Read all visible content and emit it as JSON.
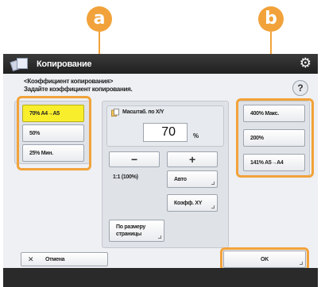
{
  "callouts": {
    "a": "a",
    "b": "b"
  },
  "window": {
    "title": "Копирование",
    "app_icon": "copy-app-icon",
    "settings_icon": "gear-icon"
  },
  "header": {
    "line1": "<Коэффициент копирования>",
    "line2": "Задайте коэффициент копирования.",
    "help_label": "?"
  },
  "preset_reduce": [
    {
      "label": "70% A4→A5",
      "selected": true
    },
    {
      "label": "50%",
      "selected": false
    },
    {
      "label": "25% Мин.",
      "selected": false
    }
  ],
  "preset_enlarge": [
    {
      "label": "400% Макс."
    },
    {
      "label": "200%"
    },
    {
      "label": "141% A5→A4"
    }
  ],
  "ratio": {
    "label": "Масштаб. по X/Y",
    "value": "70",
    "unit": "%",
    "minus": "−",
    "plus": "+",
    "buttons": {
      "one_to_one": "1:1 (100%)",
      "auto": "Авто",
      "ratio_xy": "Коэфф. XY",
      "fit_page": "По размеру страницы"
    }
  },
  "footer": {
    "cancel_label": "Отмена",
    "cancel_icon": "close-icon",
    "ok_label": "OK"
  },
  "colors": {
    "accent": "#f2a23a",
    "selected": "#f8ee2c",
    "titlebar": "#2b2b2b"
  }
}
